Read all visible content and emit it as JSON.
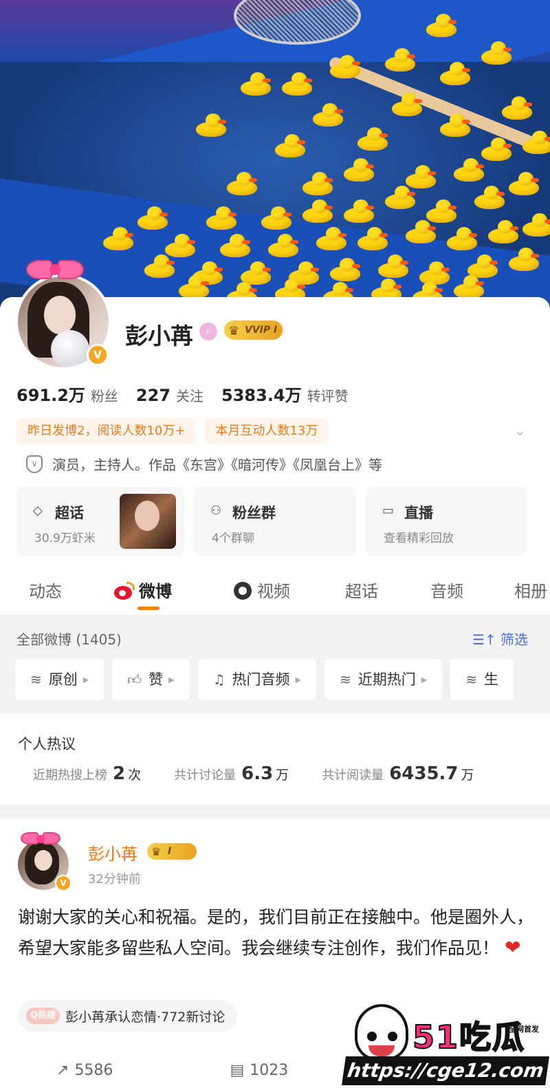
{
  "profile": {
    "name": "彭小苒",
    "vip_label": "VVIP I",
    "verified_badge": "V",
    "stats": [
      {
        "value": "691.2万",
        "label": "粉丝"
      },
      {
        "value": "227",
        "label": "关注"
      },
      {
        "value": "5383.4万",
        "label": "转评赞"
      }
    ],
    "metrics": [
      "昨日发博2，阅读人数10万+",
      "本月互动人数13万"
    ],
    "bio": "演员，主持人。作品《东宫》《暗河传》《凤凰台上》等"
  },
  "tiles": [
    {
      "title": "超话",
      "sub": "30.9万虾米",
      "icon": "diamond-icon"
    },
    {
      "title": "粉丝群",
      "sub": "4个群聊",
      "icon": "group-icon"
    },
    {
      "title": "直播",
      "sub": "查看精彩回放",
      "icon": "tv-icon"
    }
  ],
  "tabs": [
    "动态",
    "微博",
    "视频",
    "超话",
    "音频",
    "相册"
  ],
  "active_tab": "微博",
  "feed": {
    "all_count": "全部微博 (1405)",
    "filter_label": "筛选",
    "chips": [
      "原创",
      "赞",
      "热门音频",
      "近期热门",
      "生"
    ]
  },
  "hot": {
    "title": "个人热议",
    "items": [
      {
        "label": "近期热搜上榜",
        "value": "2",
        "unit": "次"
      },
      {
        "label": "共计讨论量",
        "value": "6.3",
        "unit": "万"
      },
      {
        "label": "共计阅读量",
        "value": "6435.7",
        "unit": "万"
      }
    ]
  },
  "post": {
    "author": "彭小苒",
    "vip_label": "I",
    "time": "32分钟前",
    "text": "谢谢大家的关心和祝福。是的，我们目前正在接触中。他是圈外人，希望大家能多留些私人空间。我会继续专注创作，我们作品见！",
    "topic_tag": "Q热搜",
    "topic": "彭小苒承认恋情·772新讨论",
    "reposts": "5586",
    "comments": "1023"
  },
  "watermark": {
    "brand": "51吃瓜",
    "tag": "全网首发",
    "url": "https://cge12.com"
  },
  "colors": {
    "accent": "#ff8200",
    "metric_text": "#f07a14",
    "link_blue": "#4a6fd8",
    "vip_gold": "#e8a220"
  }
}
